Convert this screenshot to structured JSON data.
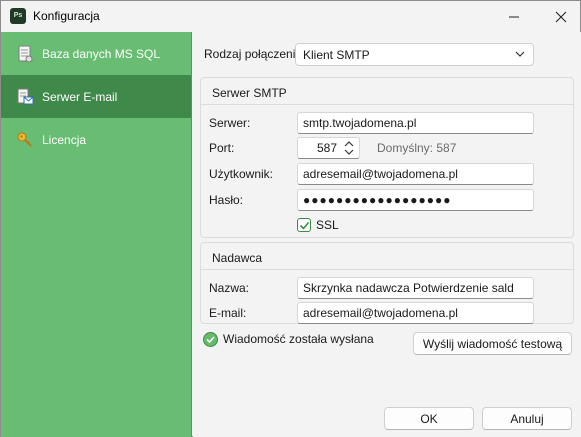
{
  "window": {
    "title": "Konfiguracja",
    "app_icon_text": "Ps"
  },
  "sidebar": {
    "items": [
      {
        "label": "Baza danych MS SQL",
        "icon": "database-icon",
        "active": false
      },
      {
        "label": "Serwer E-mail",
        "icon": "mail-server-icon",
        "active": true
      },
      {
        "label": "Licencja",
        "icon": "key-icon",
        "active": false
      }
    ]
  },
  "connection": {
    "label": "Rodzaj połączenia",
    "value": "Klient SMTP"
  },
  "smtp": {
    "title": "Serwer SMTP",
    "server_label": "Serwer:",
    "server_value": "smtp.twojadomena.pl",
    "port_label": "Port:",
    "port_value": "587",
    "port_default": "Domyślny: 587",
    "user_label": "Użytkownik:",
    "user_value": "adresemail@twojadomena.pl",
    "password_label": "Hasło:",
    "password_value": "●●●●●●●●●●●●●●●●●●",
    "ssl_label": "SSL",
    "ssl_checked": true
  },
  "sender": {
    "title": "Nadawca",
    "name_label": "Nazwa:",
    "name_value": "Skrzynka nadawcza Potwierdzenie sald",
    "email_label": "E-mail:",
    "email_value": "adresemail@twojadomena.pl"
  },
  "status": {
    "text": "Wiadomość została wysłana",
    "color": "#5cb85c"
  },
  "buttons": {
    "test": "Wyślij wiadomość testową",
    "ok": "OK",
    "cancel": "Anuluj"
  },
  "colors": {
    "sidebar": "#69bd73",
    "sidebar_active": "#3f8a4a",
    "accent": "#3f8a4a"
  }
}
